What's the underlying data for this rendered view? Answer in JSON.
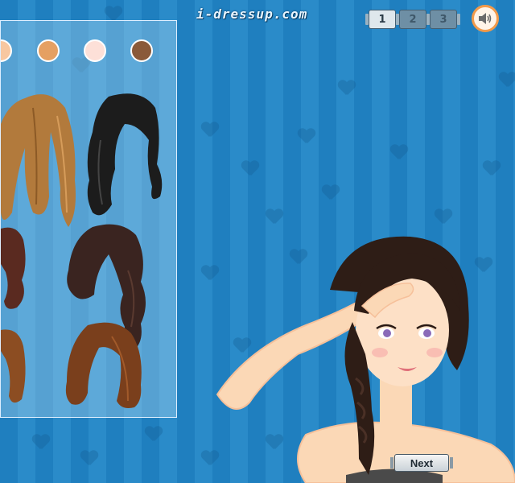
{
  "logo": {
    "text": "i-dressup.com"
  },
  "pages": [
    {
      "label": "1",
      "active": true
    },
    {
      "label": "2",
      "active": false
    },
    {
      "label": "3",
      "active": false
    }
  ],
  "sound": {
    "icon": "speaker-icon"
  },
  "skin_tones": [
    {
      "name": "skin-light",
      "color": "#f7c7a0"
    },
    {
      "name": "skin-tan",
      "color": "#e5a062"
    },
    {
      "name": "skin-pink",
      "color": "#fde0d8"
    },
    {
      "name": "skin-brown",
      "color": "#8a5a3a"
    }
  ],
  "hairstyles": [
    {
      "name": "hair-light-brown-long",
      "color": "#b27a3c"
    },
    {
      "name": "hair-black-wavy",
      "color": "#1c1c1c"
    },
    {
      "name": "hair-auburn-side",
      "color": "#5a2a20"
    },
    {
      "name": "hair-dark-brown-curly",
      "color": "#3a2420"
    },
    {
      "name": "hair-copper-bob",
      "color": "#8c4d22"
    },
    {
      "name": "hair-chestnut-short",
      "color": "#7a3f1c"
    }
  ],
  "next_button": {
    "label": "Next"
  },
  "colors": {
    "background": "#2184c4",
    "accent": "#f29a4a"
  }
}
